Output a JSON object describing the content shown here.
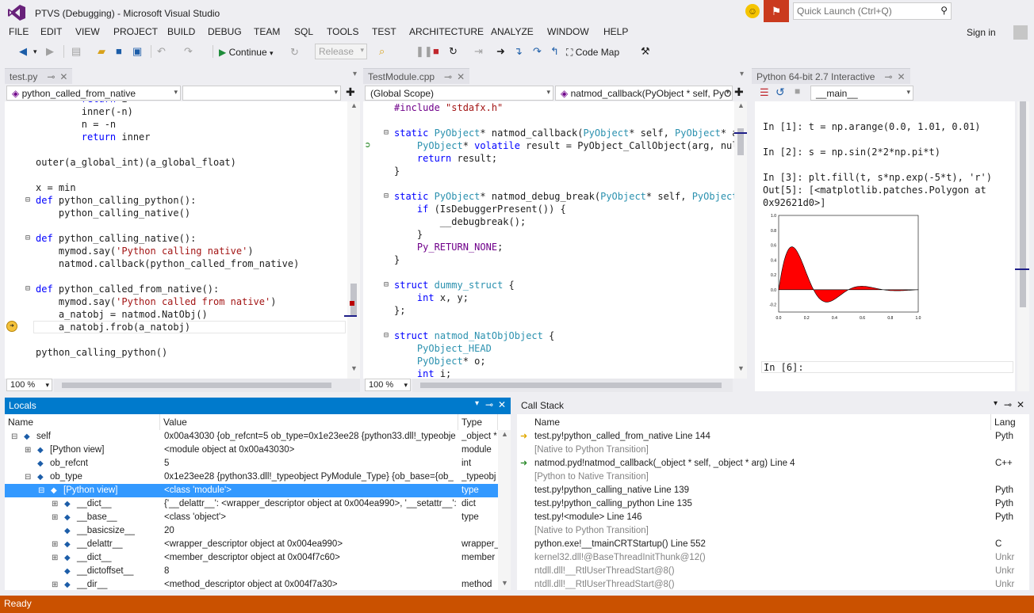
{
  "window": {
    "title": "PTVS (Debugging) - Microsoft Visual Studio"
  },
  "quick_launch": {
    "placeholder": "Quick Launch (Ctrl+Q)"
  },
  "menu": [
    "FILE",
    "EDIT",
    "VIEW",
    "PROJECT",
    "BUILD",
    "DEBUG",
    "TEAM",
    "SQL",
    "TOOLS",
    "TEST",
    "ARCHITECTURE",
    "ANALYZE",
    "WINDOW",
    "HELP"
  ],
  "sign_in": "Sign in",
  "toolbar": {
    "continue": "Continue",
    "config": "Release",
    "code_map": "Code Map"
  },
  "editor1": {
    "tab": "test.py",
    "nav_left": "python_called_from_native",
    "zoom": "100 %",
    "lines": [
      "        return i",
      "        inner(-n)",
      "        n = -n",
      "        return inner",
      "",
      "outer(a_global_int)(a_global_float)",
      "",
      "x = min",
      "def python_calling_python():",
      "    python_calling_native()",
      "",
      "def python_calling_native():",
      "    mymod.say('Python calling native')",
      "    natmod.callback(python_called_from_native)",
      "",
      "def python_called_from_native():",
      "    mymod.say('Python called from native')",
      "    a_natobj = natmod.NatObj()",
      "    a_natobj.frob(a_natobj)",
      "",
      "python_calling_python()"
    ]
  },
  "editor2": {
    "tab": "TestModule.cpp",
    "nav_left": "(Global Scope)",
    "nav_right": "natmod_callback(PyObject * self, PyOb",
    "zoom": "100 %",
    "lines": [
      "#include \"stdafx.h\"",
      "",
      "static PyObject* natmod_callback(PyObject* self, PyObject* ar",
      "    PyObject* volatile result = PyObject_CallObject(arg, null",
      "    return result;",
      "}",
      "",
      "static PyObject* natmod_debug_break(PyObject* self, PyObject*",
      "    if (IsDebuggerPresent()) {",
      "        __debugbreak();",
      "    }",
      "    Py_RETURN_NONE;",
      "}",
      "",
      "struct dummy_struct {",
      "    int x, y;",
      "};",
      "",
      "struct natmod_NatObjObject {",
      "    PyObject_HEAD",
      "    PyObject* o;",
      "    int i;"
    ]
  },
  "interactive": {
    "tab": "Python 64-bit 2.7 Interactive",
    "scope": "__main__",
    "lines": [
      "In [1]: t = np.arange(0.0, 1.01, 0.01)",
      "",
      "In [2]: s = np.sin(2*2*np.pi*t)",
      "",
      "In [3]: plt.fill(t, s*np.exp(-5*t), 'r')",
      "Out[5]: [<matplotlib.patches.Polygon at",
      "0x92621d0>]"
    ],
    "prompt": "In [6]:",
    "chart_data": {
      "type": "area",
      "function": "sin(4*pi*t)*exp(-5*t)",
      "x_range": [
        0.0,
        1.0
      ],
      "ylim": [
        -0.3,
        1.0
      ],
      "fill_color": "#ff0000",
      "x_ticks": [
        "0.0",
        "0.2",
        "0.4",
        "0.6",
        "0.8",
        "1.0"
      ],
      "y_ticks": [
        "1.0",
        "0.8",
        "0.6",
        "0.4",
        "0.2",
        "0.0",
        "-0.2"
      ]
    }
  },
  "locals": {
    "title": "Locals",
    "columns": [
      "Name",
      "Value",
      "Type"
    ],
    "rows": [
      {
        "name": "self",
        "value": "0x00a43030 {ob_refcnt=5 ob_type=0x1e23ee28 {python33.dll!_typeobje",
        "type": "_object *",
        "indent": 0,
        "exp": "⊟"
      },
      {
        "name": "[Python view]",
        "value": "<module object at 0x00a43030>",
        "type": "module",
        "indent": 1,
        "exp": "⊞"
      },
      {
        "name": "ob_refcnt",
        "value": "5",
        "type": "int",
        "indent": 1,
        "exp": ""
      },
      {
        "name": "ob_type",
        "value": "0x1e23ee28 {python33.dll!_typeobject PyModule_Type} {ob_base={ob_",
        "type": "_typeobj",
        "indent": 1,
        "exp": "⊟"
      },
      {
        "name": "[Python view]",
        "value": "<class 'module'>",
        "type": "type",
        "indent": 2,
        "exp": "⊟",
        "selected": true
      },
      {
        "name": "__dict__",
        "value": "{'__delattr__': <wrapper_descriptor object at 0x004ea990>, '__setattr__':",
        "type": "dict",
        "indent": 3,
        "exp": "⊞"
      },
      {
        "name": "__base__",
        "value": "<class 'object'>",
        "type": "type",
        "indent": 3,
        "exp": "⊞"
      },
      {
        "name": "__basicsize__",
        "value": "20",
        "type": "",
        "indent": 3,
        "exp": ""
      },
      {
        "name": "__delattr__",
        "value": "<wrapper_descriptor object at 0x004ea990>",
        "type": "wrapper_",
        "indent": 3,
        "exp": "⊞"
      },
      {
        "name": "__dict__",
        "value": "<member_descriptor object at 0x004f7c60>",
        "type": "member",
        "indent": 3,
        "exp": "⊞"
      },
      {
        "name": "__dictoffset__",
        "value": "8",
        "type": "",
        "indent": 3,
        "exp": ""
      },
      {
        "name": "__dir__",
        "value": "<method_descriptor object at 0x004f7a30>",
        "type": "method",
        "indent": 3,
        "exp": "⊞"
      }
    ]
  },
  "callstack": {
    "title": "Call Stack",
    "columns": [
      "Name",
      "Lang"
    ],
    "rows": [
      {
        "name": "test.py!python_called_from_native Line 144",
        "lang": "Pyth",
        "marker": "current",
        "gray": false
      },
      {
        "name": "[Native to Python Transition]",
        "lang": "",
        "marker": "",
        "gray": true
      },
      {
        "name": "natmod.pyd!natmod_callback(_object * self, _object * arg) Line 4",
        "lang": "C++",
        "marker": "return",
        "gray": false
      },
      {
        "name": "[Python to Native Transition]",
        "lang": "",
        "marker": "",
        "gray": true
      },
      {
        "name": "test.py!python_calling_native Line 139",
        "lang": "Pyth",
        "marker": "",
        "gray": false
      },
      {
        "name": "test.py!python_calling_python Line 135",
        "lang": "Pyth",
        "marker": "",
        "gray": false
      },
      {
        "name": "test.py!<module> Line 146",
        "lang": "Pyth",
        "marker": "",
        "gray": false
      },
      {
        "name": "[Native to Python Transition]",
        "lang": "",
        "marker": "",
        "gray": true
      },
      {
        "name": "python.exe!__tmainCRTStartup() Line 552",
        "lang": "C",
        "marker": "",
        "gray": false
      },
      {
        "name": "kernel32.dll!@BaseThreadInitThunk@12()",
        "lang": "Unkr",
        "marker": "",
        "gray": true
      },
      {
        "name": "ntdll.dll!__RtlUserThreadStart@8()",
        "lang": "Unkr",
        "marker": "",
        "gray": true
      },
      {
        "name": "ntdll.dll!__RtlUserThreadStart@8()",
        "lang": "Unkr",
        "marker": "",
        "gray": true
      }
    ]
  },
  "status": {
    "text": "Ready"
  },
  "colors": {
    "accent": "#007acc",
    "status": "#ca5100",
    "selection": "#3399ff"
  }
}
